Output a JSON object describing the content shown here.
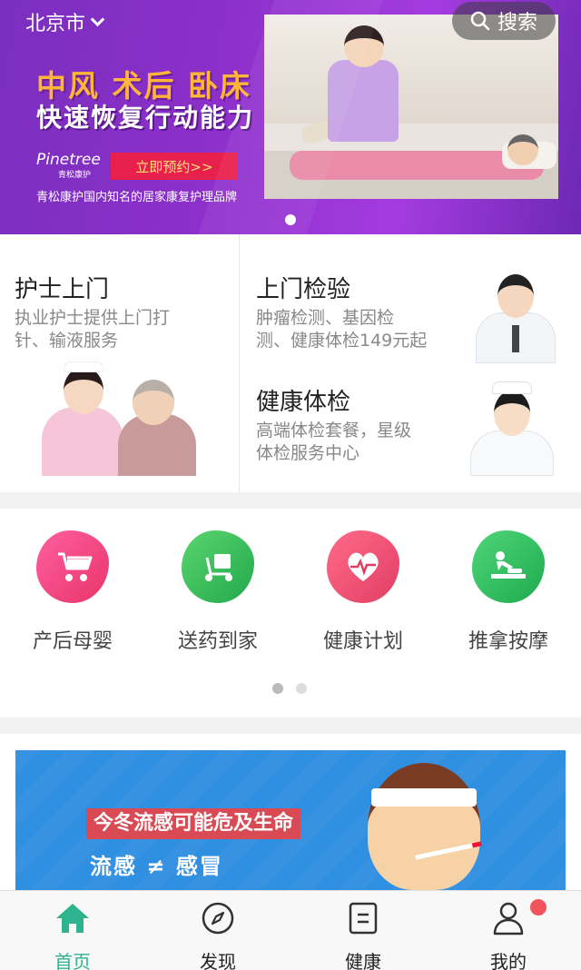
{
  "header": {
    "city": "北京市",
    "search_label": "搜索"
  },
  "banner": {
    "headline": "中风 术后 卧床",
    "headline2": "快速恢复行动能力",
    "brand_name": "Pinetree",
    "brand_sub": "青松康护",
    "book_label": "立即预约>>",
    "tagline": "青松康护国内知名的居家康复护理品牌"
  },
  "services": [
    {
      "title": "护士上门",
      "desc_line1": "执业护士提供上门打",
      "desc_line2": "针、输液服务"
    },
    {
      "title": "上门检验",
      "desc_line1": "肿瘤检测、基因检",
      "desc_line2": "测、健康体检149元起"
    },
    {
      "title": "健康体检",
      "desc_line1": "高端体检套餐，星级",
      "desc_line2": "体检服务中心"
    }
  ],
  "quick": [
    {
      "label": "产后母婴",
      "icon": "baby-stroller-icon",
      "color": "#f0457a"
    },
    {
      "label": "送药到家",
      "icon": "delivery-scooter-icon",
      "color": "#3dc25e"
    },
    {
      "label": "健康计划",
      "icon": "heart-pulse-icon",
      "color": "#ee4a6d"
    },
    {
      "label": "推拿按摩",
      "icon": "massage-icon",
      "color": "#35c466"
    }
  ],
  "ad": {
    "title": "今冬流感可能危及生命",
    "subtitle": "流感 ≠ 感冒"
  },
  "tabs": [
    {
      "label": "首页",
      "icon": "home-icon",
      "active": true
    },
    {
      "label": "发现",
      "icon": "compass-icon",
      "active": false
    },
    {
      "label": "健康",
      "icon": "document-icon",
      "active": false
    },
    {
      "label": "我的",
      "icon": "user-icon",
      "active": false
    }
  ],
  "colors": {
    "accent": "#2db48e",
    "banner": "#8b2fc9",
    "badge": "#f2545b"
  }
}
